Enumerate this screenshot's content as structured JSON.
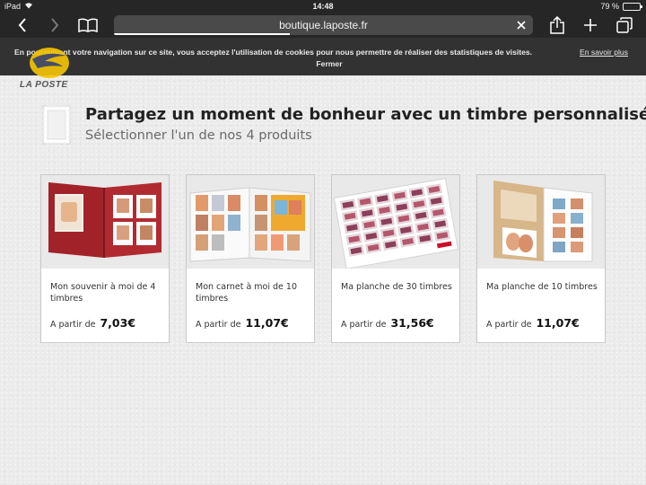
{
  "status_bar": {
    "device": "iPad",
    "time": "14:48",
    "battery": "79 %",
    "battery_level": 0.79
  },
  "browser": {
    "url": "boutique.laposte.fr",
    "load_progress": 0.42
  },
  "cookie_banner": {
    "message": "En poursuivant votre navigation sur ce site, vous acceptez l'utilisation de cookies pour nous permettre de réaliser des statistiques de visites.",
    "more_link": "En savoir plus",
    "close_label": "Fermer"
  },
  "brand": {
    "name": "LA POSTE",
    "color": "#f6c500"
  },
  "page": {
    "title": "Partagez un moment de bonheur avec un timbre personnalisé",
    "subtitle": "Sélectionner l'un de nos 4 produits"
  },
  "products": [
    {
      "name": "Mon souvenir à moi de 4 timbres",
      "price_prefix": "A partir de",
      "price": "7,03€"
    },
    {
      "name": "Mon carnet à moi de 10 timbres",
      "price_prefix": "A partir de",
      "price": "11,07€"
    },
    {
      "name": "Ma planche de 30 timbres",
      "price_prefix": "A partir de",
      "price": "31,56€"
    },
    {
      "name": "Ma planche de 10 timbres",
      "price_prefix": "A partir de",
      "price": "11,07€"
    }
  ]
}
